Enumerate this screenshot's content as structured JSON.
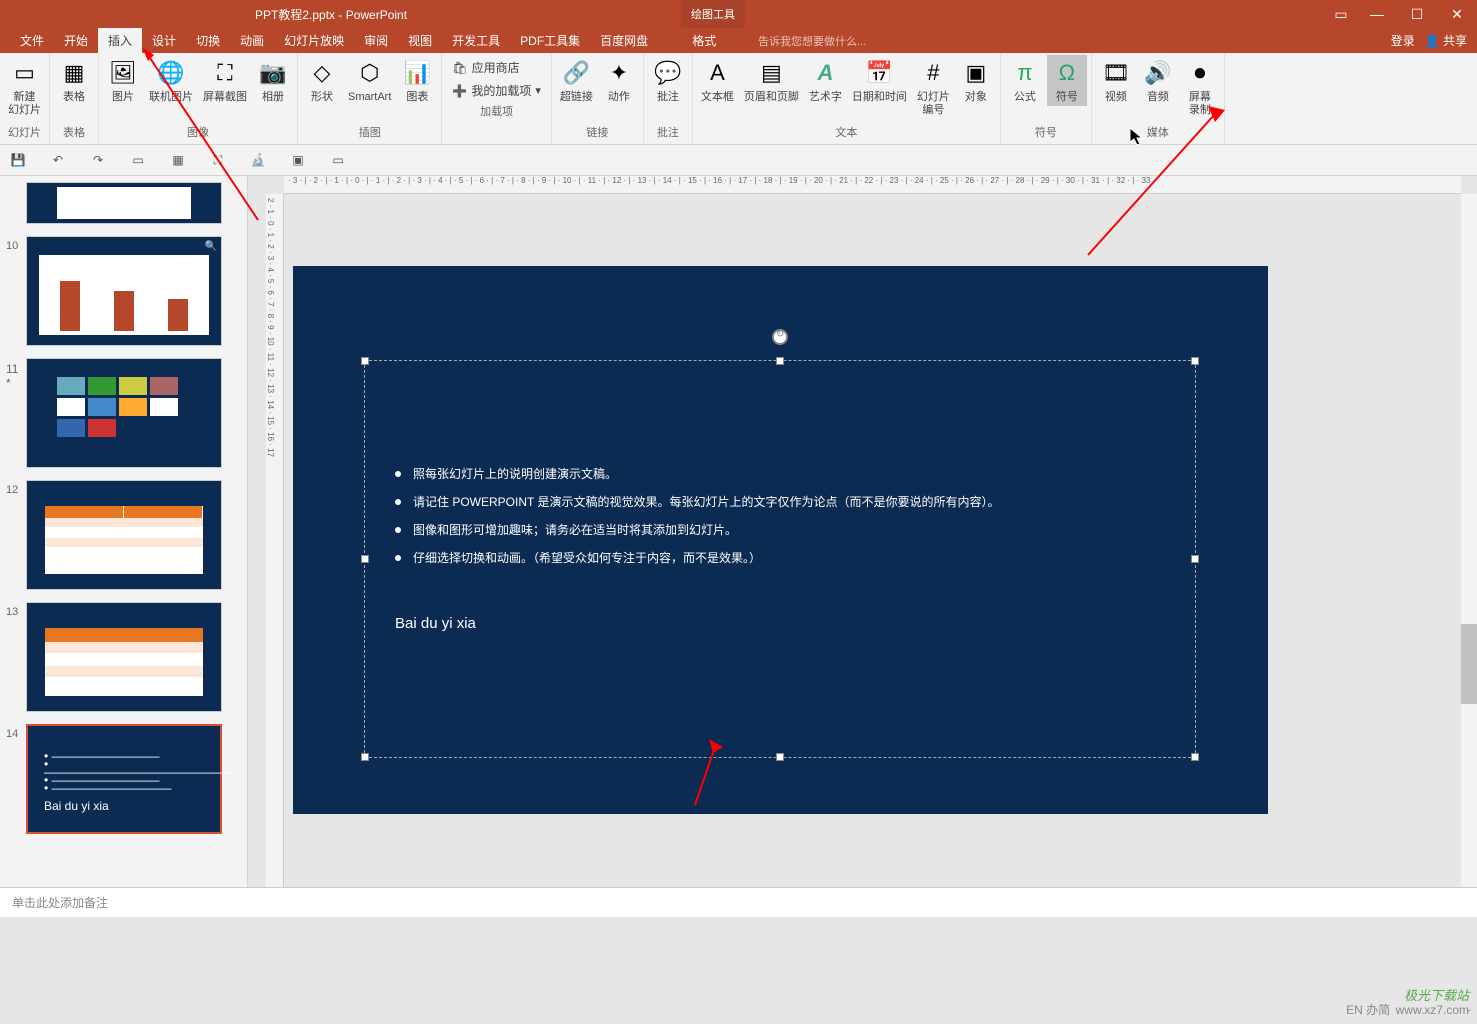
{
  "title": {
    "filename": "PPT教程2.pptx - PowerPoint",
    "context_tab": "绘图工具",
    "context_sub": "格式"
  },
  "window": {
    "login": "登录",
    "share": "共享"
  },
  "menu": {
    "file": "文件",
    "home": "开始",
    "insert": "插入",
    "design": "设计",
    "transition": "切换",
    "animation": "动画",
    "slideshow": "幻灯片放映",
    "review": "审阅",
    "view": "视图",
    "developer": "开发工具",
    "pdf": "PDF工具集",
    "baidu": "百度网盘",
    "format": "格式",
    "tellme": "告诉我您想要做什么..."
  },
  "ribbon": {
    "slides": {
      "new": "新建\n幻灯片",
      "group": "幻灯片"
    },
    "tables": {
      "table": "表格",
      "group": "表格"
    },
    "images": {
      "picture": "图片",
      "online": "联机图片",
      "screenshot": "屏幕截图",
      "album": "相册",
      "group": "图像"
    },
    "illustration": {
      "shapes": "形状",
      "smartart": "SmartArt",
      "chart": "图表",
      "group": "插图"
    },
    "addins": {
      "store": "应用商店",
      "myaddins": "我的加载项",
      "group": "加载项"
    },
    "links": {
      "hyperlink": "超链接",
      "action": "动作",
      "group": "链接"
    },
    "comments": {
      "comment": "批注",
      "group": "批注"
    },
    "text": {
      "textbox": "文本框",
      "headerfooter": "页眉和页脚",
      "wordart": "艺术字",
      "datetime": "日期和时间",
      "slidenum": "幻灯片\n编号",
      "object": "对象",
      "group": "文本"
    },
    "symbols": {
      "equation": "公式",
      "symbol": "符号",
      "group": "符号"
    },
    "media": {
      "video": "视频",
      "audio": "音频",
      "screenrec": "屏幕\n录制",
      "group": "媒体"
    }
  },
  "slides": [
    {
      "num": ""
    },
    {
      "num": "10"
    },
    {
      "num": "11",
      "star": "*"
    },
    {
      "num": "12"
    },
    {
      "num": "13"
    },
    {
      "num": "14"
    }
  ],
  "content": {
    "bullets": [
      "照每张幻灯片上的说明创建演示文稿。",
      "请记住 POWERPOINT 是演示文稿的视觉效果。每张幻灯片上的文字仅作为论点（而不是你要说的所有内容）。",
      "图像和图形可增加趣味；请务必在适当时将其添加到幻灯片。",
      "仔细选择切换和动画。（希望受众如何专注于内容，而不是效果。）"
    ],
    "input": "Bai du yi xia"
  },
  "notes": {
    "placeholder": "单击此处添加备注"
  },
  "ruler_h": "· 3 · | · 2 · | · 1 · | · 0 · | · 1 · | · 2 · | · 3 · | · 4 · | · 5 · | · 6 · | · 7 · | · 8 · | · 9 · | · 10 · | · 11 · | · 12 · | · 13 · | · 14 · | · 15 · | · 16 · | · 17 · | · 18 · | · 19 · | · 20 · | · 21 · | · 22 · | · 23 · | · 24 · | · 25 · | · 26 · | · 27 · | · 28 · | · 29 · | · 30 · | · 31 · | · 32 · | · 33 ·",
  "ruler_v": "2 · 1 · 0 · 1 · 2 · 3 · 4 · 5 · 6 · 7 · 8 · 9 · 10 · 11 · 12 · 13 · 14 · 15 · 16 · 17",
  "watermark": {
    "brand": "极光下载站",
    "url": "www.xz7.com",
    "ime": "EN 办简"
  }
}
